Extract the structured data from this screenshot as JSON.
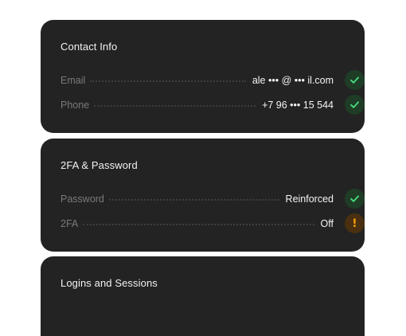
{
  "contact": {
    "title": "Contact Info",
    "rows": [
      {
        "label": "Email",
        "value": "ale ••• @ ••• il.com",
        "status": "ok"
      },
      {
        "label": "Phone",
        "value": "+7 96 ••• 15 544",
        "status": "ok"
      }
    ]
  },
  "security": {
    "title": "2FA & Password",
    "rows": [
      {
        "label": "Password",
        "value": "Reinforced",
        "status": "ok"
      },
      {
        "label": "2FA",
        "value": "Off",
        "status": "warn",
        "status_glyph": "!"
      }
    ]
  },
  "sessions": {
    "title": "Logins and Sessions"
  },
  "colors": {
    "card_bg": "#232323",
    "ok_bg": "#1f3d26",
    "ok_check": "#4ade80",
    "warn_bg": "#4a3010",
    "warn_fg": "#f59e0b"
  },
  "icons": {
    "ok": "check-icon",
    "warn": "exclamation-icon"
  }
}
